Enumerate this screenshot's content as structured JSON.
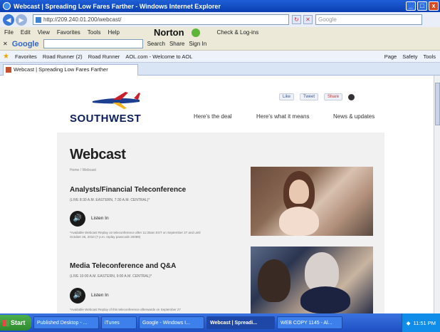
{
  "window": {
    "title": "Webcast | Spreading Low Fares Farther - Windows Internet Explorer",
    "min": "_",
    "max": "□",
    "close": "x"
  },
  "addressbar": {
    "url": "http://209.240.01.200/webcast/",
    "search_placeholder": "Google"
  },
  "menubar": {
    "items": [
      "File",
      "Edit",
      "View",
      "Favorites",
      "Tools",
      "Help"
    ],
    "norton": "Norton",
    "check_login": "Check & Log-ins"
  },
  "googlebar": {
    "logo": "Google",
    "items": [
      "Search",
      "Share",
      "Sign In"
    ]
  },
  "favbar": {
    "items": [
      "Favorites",
      "Road Runner (2)",
      "Road Runner",
      "AOL.com - Welcome to AOL"
    ],
    "right": [
      "Page",
      "Safety",
      "Tools"
    ]
  },
  "tab": {
    "label": "Webcast | Spreading Low Fares Farther"
  },
  "site": {
    "logo": "SOUTHWEST",
    "social": [
      "Like",
      "Tweet",
      "Share"
    ],
    "nav": [
      "Here's the deal",
      "Here's what it means",
      "News & updates"
    ],
    "page_title": "Webcast",
    "breadcrumb": "Home / Webcast",
    "items": [
      {
        "title": "Analysts/Financial Teleconference",
        "time": "(LIVE 8:30 A.M. EASTERN, 7:30 A.M. CENTRAL)*",
        "listen": "Listen In",
        "note": "*Available Webcast Replay on teleconference after 11:30am EST on September 27 and until October 26, 2010 (7 p.m. replay passcode 20089)"
      },
      {
        "title": "Media Teleconference and Q&A",
        "time": "(LIVE 10:00 A.M. EASTERN, 9:00 A.M. CENTRAL)*",
        "listen": "Listen In",
        "note": "*Available Webcast Replay of this teleconference afterwards on September 27"
      }
    ]
  },
  "taskbar": {
    "start": "Start",
    "tasks": [
      "Published Desktop - ...",
      "iTunes",
      "Google - Windows I...",
      "Webcast | Spreadi...",
      "WEB COPY 1145 - Al..."
    ],
    "clock": "11:51 PM"
  }
}
